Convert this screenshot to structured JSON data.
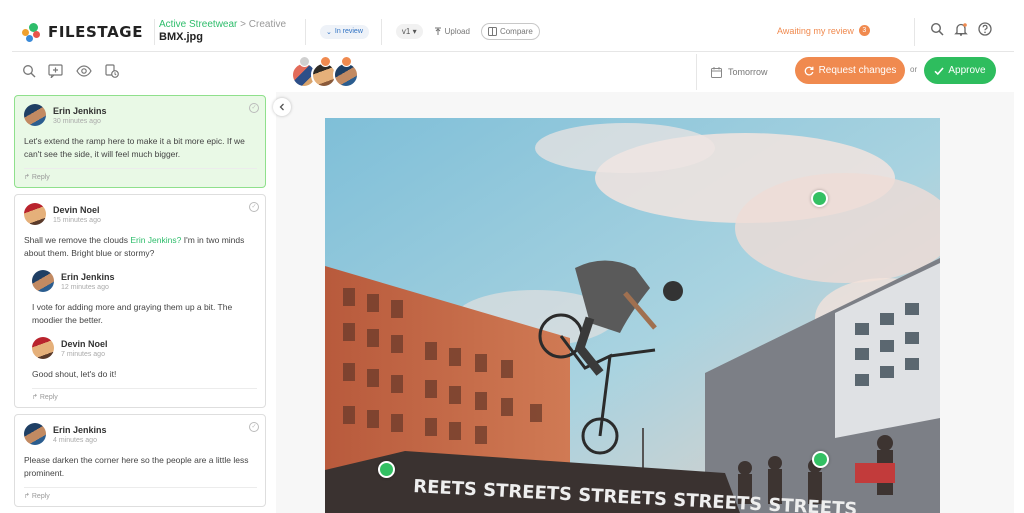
{
  "header": {
    "logo_text": "FILESTAGE",
    "breadcrumb_project": "Active Streetwear",
    "breadcrumb_separator": ">",
    "breadcrumb_section": "Creative",
    "file_name": "BMX.jpg",
    "status_label": "In review",
    "version_label": "v1",
    "upload_label": "Upload",
    "compare_label": "Compare",
    "awaiting_label": "Awaiting my review",
    "awaiting_count": "3"
  },
  "toolbar": {
    "due_label": "Tomorrow",
    "request_changes_label": "Request changes",
    "or_label": "or",
    "approve_label": "Approve"
  },
  "comments": [
    {
      "author": "Erin Jenkins",
      "time": "30 minutes ago",
      "text": "Let's extend the ramp here to make it a bit more epic. If we can't see the side, it will feel much bigger.",
      "reply_label": "Reply"
    },
    {
      "author": "Devin Noel",
      "time": "15 minutes ago",
      "text_before": "Shall we remove the clouds ",
      "mention": "Erin Jenkins?",
      "text_after": " I'm in two minds about them. Bright blue or stormy?",
      "replies": [
        {
          "author": "Erin Jenkins",
          "time": "12 minutes ago",
          "text": "I vote for adding more and graying them up a bit. The moodier the better."
        },
        {
          "author": "Devin Noel",
          "time": "7 minutes ago",
          "text": "Good shout, let's do it!"
        }
      ],
      "reply_label": "Reply"
    },
    {
      "author": "Erin Jenkins",
      "time": "4 minutes ago",
      "text": "Please darken the corner here so the people are a little less prominent.",
      "reply_label": "Reply"
    }
  ],
  "canvas": {
    "banner_text": "REETS STREETS STREETS STREETS STREETS"
  },
  "colors": {
    "brand_green": "#2ebd5e",
    "accent_orange": "#f08a4f",
    "status_blue": "#2f72c4"
  }
}
